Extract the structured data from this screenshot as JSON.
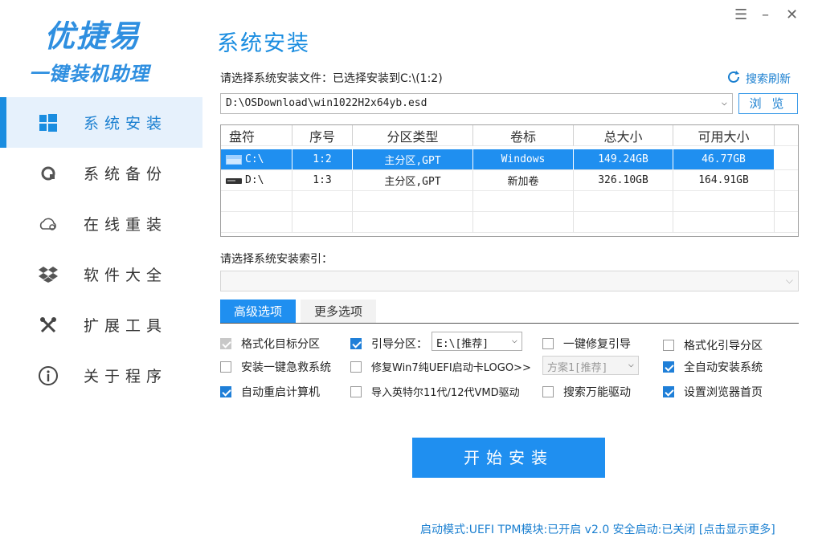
{
  "app": {
    "logo_title": "优捷易",
    "logo_subtitle": "一键装机助理"
  },
  "sidebar": {
    "items": [
      {
        "label": "系统安装",
        "icon": "windows-icon",
        "active": true
      },
      {
        "label": "系统备份",
        "icon": "backup-icon",
        "active": false
      },
      {
        "label": "在线重装",
        "icon": "cloud-icon",
        "active": false
      },
      {
        "label": "软件大全",
        "icon": "dropbox-icon",
        "active": false
      },
      {
        "label": "扩展工具",
        "icon": "tools-icon",
        "active": false
      },
      {
        "label": "关于程序",
        "icon": "info-icon",
        "active": false
      }
    ]
  },
  "window_controls": {
    "menu": "☰",
    "minimize": "–",
    "close": "✕"
  },
  "main": {
    "page_title": "系统安装",
    "file_label": "请选择系统安装文件：已选择安装到C:\\(1:2)",
    "refresh_label": "搜索刷新",
    "file_path": "D:\\OSDownload\\win1022H2x64yb.esd",
    "browse_label": "浏 览",
    "index_label": "请选择系统安装索引：",
    "index_value": ""
  },
  "table": {
    "headers": [
      "盘符",
      "序号",
      "分区类型",
      "卷标",
      "总大小",
      "可用大小"
    ],
    "rows": [
      {
        "drive": "C:\\",
        "index": "1:2",
        "type": "主分区,GPT",
        "label": "Windows",
        "total": "149.24GB",
        "free": "46.77GB",
        "selected": true
      },
      {
        "drive": "D:\\",
        "index": "1:3",
        "type": "主分区,GPT",
        "label": "新加卷",
        "total": "326.10GB",
        "free": "164.91GB",
        "selected": false
      }
    ]
  },
  "tabs": {
    "advanced": "高级选项",
    "more": "更多选项"
  },
  "options": {
    "format_target": {
      "label": "格式化目标分区",
      "state": "disabled-checked"
    },
    "boot_partition": {
      "label": "引导分区：",
      "state": "checked",
      "value": "E:\\[推荐]"
    },
    "repair_boot": {
      "label": "一键修复引导",
      "state": "unchecked"
    },
    "format_boot": {
      "label": "格式化引导分区",
      "state": "unchecked"
    },
    "install_rescue": {
      "label": "安装一键急救系统",
      "state": "unchecked"
    },
    "repair_logo": {
      "label": "修复Win7纯UEFI启动卡LOGO>>",
      "state": "unchecked",
      "value": "方案1[推荐]"
    },
    "auto_install": {
      "label": "全自动安装系统",
      "state": "checked"
    },
    "auto_restart": {
      "label": "自动重启计算机",
      "state": "checked"
    },
    "import_vmd": {
      "label": "导入英特尔11代/12代VMD驱动",
      "state": "unchecked"
    },
    "search_driver": {
      "label": "搜索万能驱动",
      "state": "unchecked"
    },
    "set_homepage": {
      "label": "设置浏览器首页",
      "state": "checked"
    }
  },
  "start_label": "开始安装",
  "status": "启动模式:UEFI TPM模块:已开启 v2.0 安全启动:已关闭 [点击显示更多]",
  "colors": {
    "accent": "#1f8ff0",
    "sidebar_active_bg": "#e6f1fc"
  }
}
